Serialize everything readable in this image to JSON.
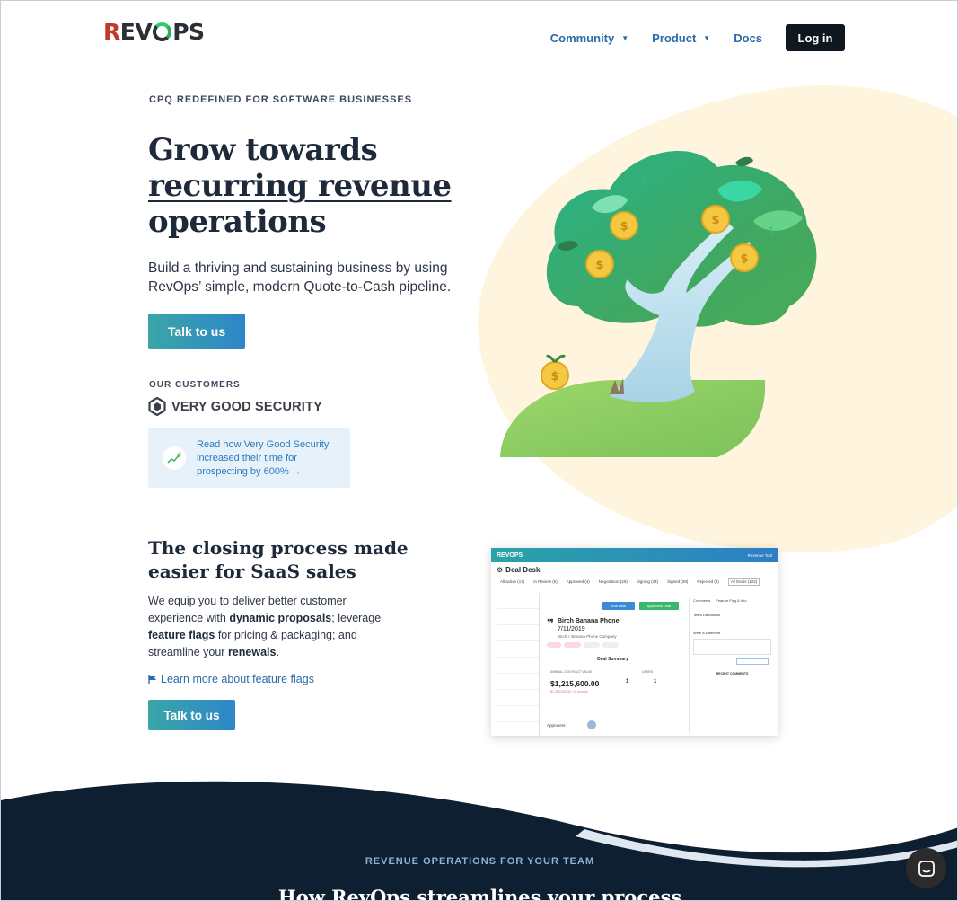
{
  "header": {
    "logo_text": "REVOPS",
    "nav": [
      {
        "label": "Community",
        "has_dropdown": true
      },
      {
        "label": "Product",
        "has_dropdown": true
      },
      {
        "label": "Docs",
        "has_dropdown": false
      }
    ],
    "login_label": "Log in"
  },
  "hero": {
    "eyebrow": "CPQ REDEFINED FOR SOFTWARE BUSINESSES",
    "title_line1": "Grow towards",
    "title_line2": "recurring revenue",
    "title_line3": "operations",
    "subtitle": "Build a thriving and sustaining business by using RevOps’ simple, modern Quote-to-Cash pipeline.",
    "cta_label": "Talk to us",
    "customers_label": "OUR CUSTOMERS",
    "customer_name": "VERY GOOD SECURITY",
    "case_study_text": "Read how Very Good Security increased their time for prospecting by 600% →"
  },
  "closing": {
    "title": "The closing process made easier for SaaS sales",
    "body_1": "We equip you to deliver better customer experience with ",
    "body_bold_1": "dynamic proposals",
    "body_2": "; leverage ",
    "body_bold_2": "feature flags",
    "body_3": " for pricing & packaging; and streamline your ",
    "body_bold_3": "renewals",
    "body_4": ".",
    "link_label": "Learn more about feature flags",
    "cta_label": "Talk to us"
  },
  "app_preview": {
    "brand": "REVOPS",
    "user": "Revenue Tool",
    "title": "Deal Desk",
    "tabs": [
      "All active (17)",
      "In Review (5)",
      "Approved (4)",
      "Negotiation (29)",
      "Signing (24)",
      "Signed (28)",
      "Rejected (4)",
      "All Deals (122)"
    ],
    "edit_label": "Edit Deal",
    "approved_label": "Approved Deal",
    "deal_name": "Birch Banana Phone",
    "deal_date": "7/11/2019",
    "deal_sub": "Birch + Banana Phone Company",
    "summary_label": "Deal Summary",
    "acv_label": "ANNUAL CONTRACT VALUE",
    "users_label": "USERS",
    "acv_value": "$1,215,600.00",
    "acv_sub": "$1,215,600.00 / 12 months",
    "col2": "1",
    "col3": "1",
    "approvers_label": "Approvers",
    "right_tabs": [
      "Comments",
      "Feature Flag & Info"
    ],
    "team_label": "Team Discussion",
    "write_label": "Write a comment",
    "recent_label": "RECENT COMMENTS"
  },
  "footer": {
    "eyebrow": "REVENUE OPERATIONS FOR YOUR TEAM",
    "title": "How RevOps streamlines your process"
  },
  "colors": {
    "accent_blue": "#2a6ba8",
    "dark_navy": "#0d1f30",
    "blob": "#fff5de",
    "cta_gradient_start": "#3aa6a8",
    "cta_gradient_end": "#2d86c8"
  }
}
